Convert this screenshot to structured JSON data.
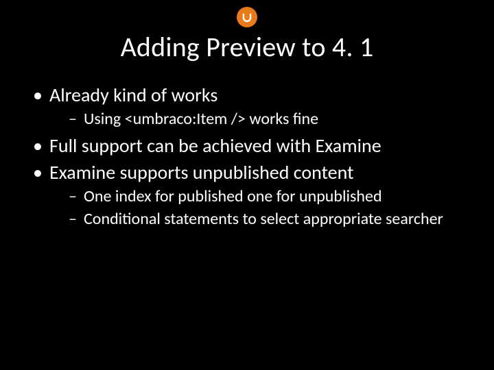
{
  "colors": {
    "background": "#000000",
    "text": "#ffffff",
    "accent": "#e87b1c"
  },
  "title": "Adding Preview to 4. 1",
  "bullets": [
    {
      "text": "Already kind of works",
      "children": [
        {
          "text": "Using <umbraco:Item /> works fine"
        }
      ]
    },
    {
      "text": "Full support can be achieved with Examine",
      "children": []
    },
    {
      "text": "Examine supports unpublished content",
      "children": [
        {
          "text": "One index for published one for unpublished"
        },
        {
          "text": "Conditional statements to select appropriate searcher"
        }
      ]
    }
  ]
}
